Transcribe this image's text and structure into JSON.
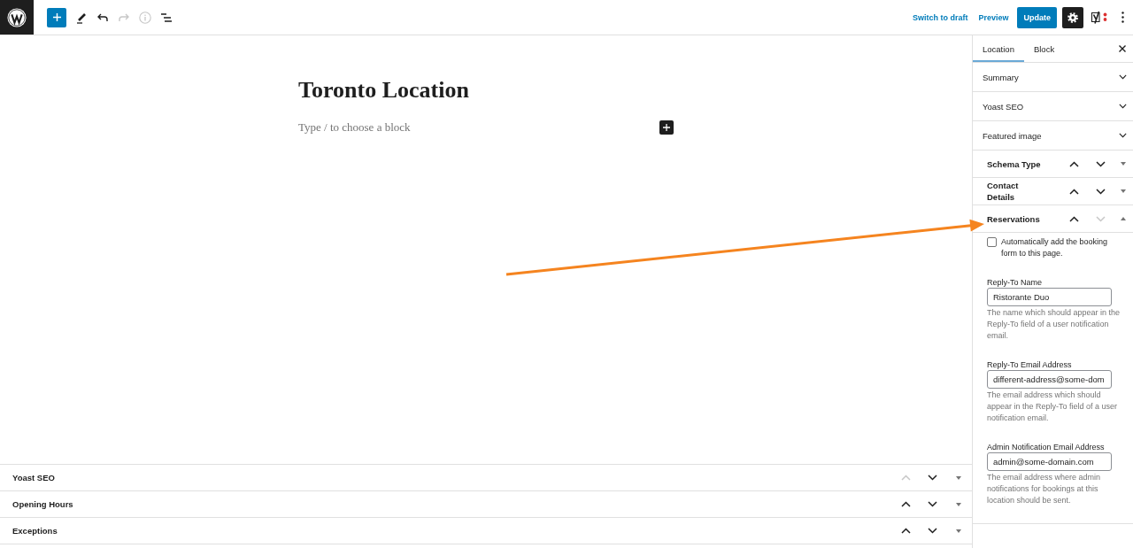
{
  "header": {
    "tools": [
      {
        "kind": "inserter",
        "disabled": false
      },
      {
        "kind": "tools",
        "disabled": false
      },
      {
        "kind": "undo",
        "disabled": false
      },
      {
        "kind": "redo",
        "disabled": true
      },
      {
        "kind": "details",
        "disabled": true
      },
      {
        "kind": "outline",
        "disabled": false
      }
    ],
    "actions": [
      {
        "kind": "link",
        "label": "Switch to draft"
      },
      {
        "kind": "link",
        "label": "Preview"
      },
      {
        "kind": "primary",
        "label": "Update"
      }
    ],
    "right_tools": [
      {
        "kind": "settings",
        "pressed": true
      },
      {
        "kind": "seo",
        "pressed": false
      },
      {
        "kind": "more",
        "pressed": false
      }
    ]
  },
  "editor": {
    "title": "Toronto Location",
    "block": {
      "placeholder": "Type / to choose a block"
    }
  },
  "metaboxes": [
    {
      "title": "Yoast SEO",
      "up_disabled": true,
      "down_disabled": false,
      "expanded": false
    },
    {
      "title": "Opening Hours",
      "up_disabled": false,
      "down_disabled": false,
      "expanded": false
    },
    {
      "title": "Exceptions",
      "up_disabled": false,
      "down_disabled": false,
      "expanded": false
    }
  ],
  "sidebar": {
    "tabs": [
      {
        "label": "Location",
        "selected": true
      },
      {
        "label": "Block",
        "selected": false
      }
    ],
    "panels": [
      {
        "title": "Summary",
        "expanded": false
      },
      {
        "title": "Yoast SEO",
        "expanded": false
      },
      {
        "title": "Featured image",
        "expanded": false
      }
    ],
    "metaboxes": [
      {
        "title": "Schema Type",
        "up_disabled": false,
        "down_disabled": false,
        "expanded": false
      },
      {
        "title": "Contact Details",
        "up_disabled": false,
        "down_disabled": false,
        "expanded": false
      },
      {
        "title": "Reservations",
        "up_disabled": false,
        "down_disabled": true,
        "expanded": true,
        "checkbox": {
          "label": "Automatically add the booking form to this page.",
          "checked": false
        },
        "fields": [
          {
            "label": "Reply-To Name",
            "value": "Ristorante Duo",
            "help": "The name which should appear in the Reply-To field of a user notification email."
          },
          {
            "label": "Reply-To Email Address",
            "value": "different-address@some-dom",
            "help": "The email address which should appear in the Reply-To field of a user notification email."
          },
          {
            "label": "Admin Notification Email Address",
            "value": "admin@some-domain.com",
            "help": "The email address where admin notifications for bookings at this location should be sent."
          }
        ]
      }
    ]
  },
  "annotations": [
    {
      "kind": "arrow"
    }
  ]
}
